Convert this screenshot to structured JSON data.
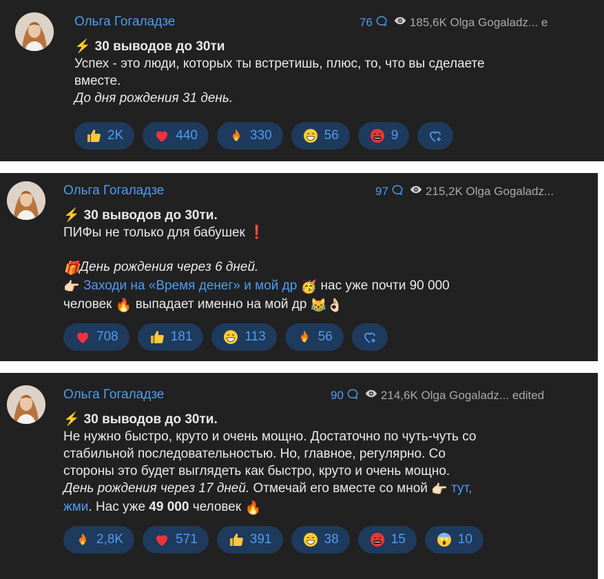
{
  "posts": [
    {
      "author": "Ольга Гогаладзе",
      "comments": "76",
      "views_line": "185,6K Olga Gogaladz... e",
      "title": "30 выводов до 30ти",
      "lines": [
        "Успех - это люди, которых ты встретишь, плюс, то, что вы сделаете",
        "вместе."
      ],
      "italic_line": "До дня рождения 31 день.",
      "reactions": [
        {
          "icon": "thumbs-up-icon",
          "count": "2K"
        },
        {
          "icon": "heart-icon",
          "count": "440"
        },
        {
          "icon": "fire-icon",
          "count": "330"
        },
        {
          "icon": "grin-icon",
          "count": "56"
        },
        {
          "icon": "angry-icon",
          "count": "9"
        }
      ]
    },
    {
      "author": "Ольга Гогаладзе",
      "comments": "97",
      "views_line": "215,2K Olga Gogaladz...",
      "title": "30 выводов до 30ти.",
      "line1": "ПИФы не только для бабушек",
      "gift_line": "День рождения через 6 дней.",
      "link_text": "Заходи на «Время денег» и мой др",
      "after_link": "нас уже почти 90 000",
      "line_last_a": "человек",
      "line_last_b": "выпадает именно на мой др",
      "reactions": [
        {
          "icon": "heart-icon",
          "count": "708"
        },
        {
          "icon": "thumbs-up-icon",
          "count": "181"
        },
        {
          "icon": "grin-icon",
          "count": "113"
        },
        {
          "icon": "fire-icon",
          "count": "56"
        }
      ]
    },
    {
      "author": "Ольга Гогаладзе",
      "comments": "90",
      "views_line": "214,6K Olga Gogaladz... edited",
      "title": "30 выводов до 30ти.",
      "lines": [
        "Не нужно быстро, круто и очень мощно. Достаточно по чуть-чуть со",
        "стабильной последовательностью. Но, главное, регулярно. Со",
        "стороны это будет выглядеть как быстро, круто и очень мощно."
      ],
      "italic_part": "День рождения через 17 дней.",
      "after_italic": "Отмечай его вместе со мной",
      "link1": "тут,",
      "link2": "жми",
      "tail_a": ". Нас уже",
      "tail_bold": "49 000",
      "tail_b": "человек",
      "reactions": [
        {
          "icon": "fire-icon",
          "count": "2,8K"
        },
        {
          "icon": "heart-icon",
          "count": "571"
        },
        {
          "icon": "thumbs-up-icon",
          "count": "391"
        },
        {
          "icon": "grin-icon",
          "count": "38"
        },
        {
          "icon": "angry-icon",
          "count": "15"
        },
        {
          "icon": "scream-icon",
          "count": "10"
        }
      ]
    }
  ],
  "colors": {
    "bg": "#212121",
    "accent": "#4f9cf1",
    "pill": "#1e3a5c"
  }
}
